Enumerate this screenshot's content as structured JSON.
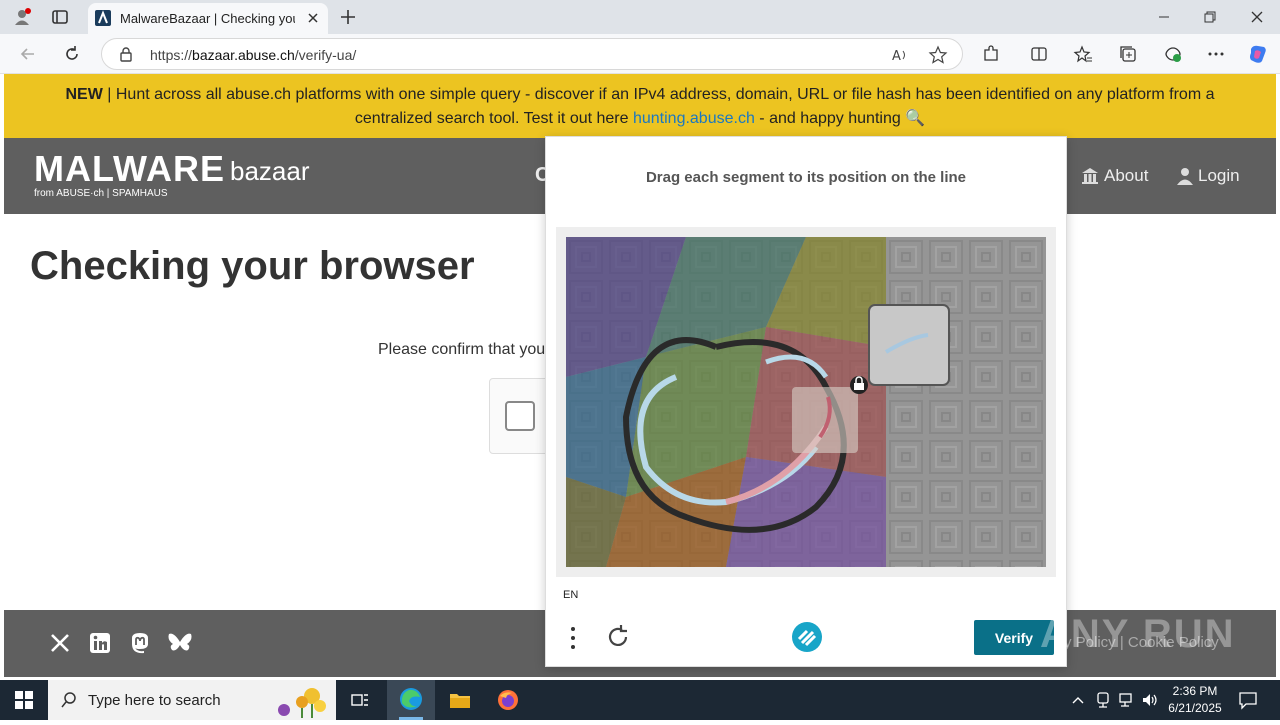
{
  "browser": {
    "tab_title": "MalwareBazaar | Checking your b",
    "url_host": "bazaar.abuse.ch",
    "url_prefix": "https://",
    "url_path": "/verify-ua/"
  },
  "banner": {
    "new_label": "NEW",
    "text": " | Hunt across all abuse.ch platforms with one simple query - discover if an IPv4 address, domain, URL or file hash has been identified on any platform from a centralized search tool. Test it out here ",
    "link": "hunting.abuse.ch",
    "suffix": " - and happy hunting 🔍"
  },
  "nav": {
    "logo_main": "MALWARE",
    "logo_sub": "bazaar",
    "logo_from": "from ABUSE·ch | SPAMHAUS",
    "partial_item": "C",
    "about": "About",
    "login": "Login"
  },
  "main": {
    "title": "Checking your browser",
    "confirm_text": "Please confirm that you"
  },
  "captcha": {
    "prompt": "Drag each segment to its position on the line",
    "lang": "EN",
    "verify": "Verify"
  },
  "footer": {
    "links": "y Policy  |  Cookie Policy"
  },
  "taskbar": {
    "search_placeholder": "Type here to search",
    "time": "2:36 PM",
    "date": "6/21/2025"
  },
  "watermark": "ANY RUN"
}
